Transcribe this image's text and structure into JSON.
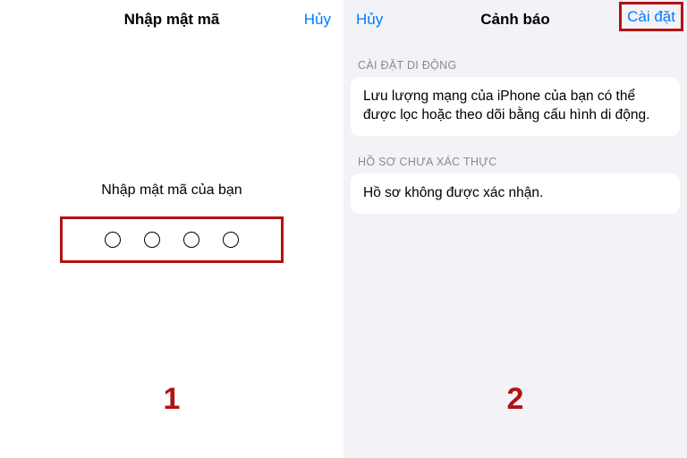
{
  "leftPane": {
    "nav": {
      "title": "Nhập mật mã",
      "cancel": "Hủy"
    },
    "prompt": "Nhập mật mã của bạn",
    "stepNumber": "1"
  },
  "rightPane": {
    "nav": {
      "title": "Cảnh báo",
      "cancel": "Hủy",
      "install": "Cài đặt"
    },
    "sections": [
      {
        "header": "CÀI ĐẶT DI ĐỘNG",
        "body": "Lưu lượng mạng của iPhone của bạn có thể được lọc hoặc theo dõi bằng cấu hình di động."
      },
      {
        "header": "HỒ SƠ CHƯA XÁC THỰC",
        "body": "Hồ sơ không được xác nhận."
      }
    ],
    "stepNumber": "2"
  }
}
